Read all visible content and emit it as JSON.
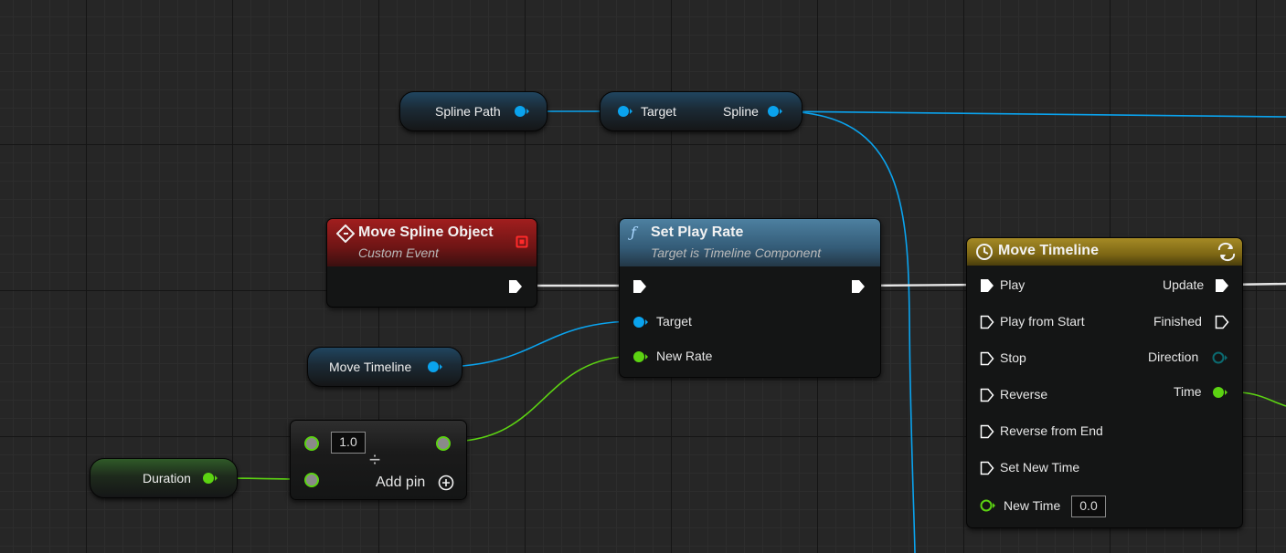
{
  "nodes": {
    "spline_path": {
      "label": "Spline Path"
    },
    "spline_getter": {
      "target_label": "Target",
      "spline_label": "Spline"
    },
    "custom_event": {
      "title": "Move Spline Object",
      "subtitle": "Custom Event"
    },
    "set_play_rate": {
      "title": "Set Play Rate",
      "subtitle": "Target is Timeline Component",
      "target_label": "Target",
      "new_rate_label": "New Rate"
    },
    "timeline_var": {
      "label": "Move Timeline"
    },
    "divide": {
      "value": "1.0",
      "add_pin_label": "Add pin",
      "operator": "÷"
    },
    "duration_var": {
      "label": "Duration"
    },
    "move_timeline": {
      "title": "Move Timeline",
      "inputs": [
        "Play",
        "Play from Start",
        "Stop",
        "Reverse",
        "Reverse from End",
        "Set New Time"
      ],
      "outputs": [
        "Update",
        "Finished",
        "Direction",
        "Time"
      ],
      "new_time_label": "New Time",
      "new_time_value": "0.0"
    }
  },
  "icons": {
    "event": "diamond-event-icon",
    "function": "function-f-icon",
    "timeline": "clock-icon",
    "loop": "loop-icon",
    "add": "plus-circle-icon",
    "delegate": "red-square-icon"
  },
  "colors": {
    "object_pin": "#0aa3ee",
    "float_pin": "#5cd312",
    "exec_pin": "#ffffff",
    "enum_pin": "#0b6a70",
    "wildcard_pin": "#8a8a8a",
    "event_header": "#a11e1e",
    "function_header": "#4d80a0",
    "timeline_header": "#a58a25"
  }
}
